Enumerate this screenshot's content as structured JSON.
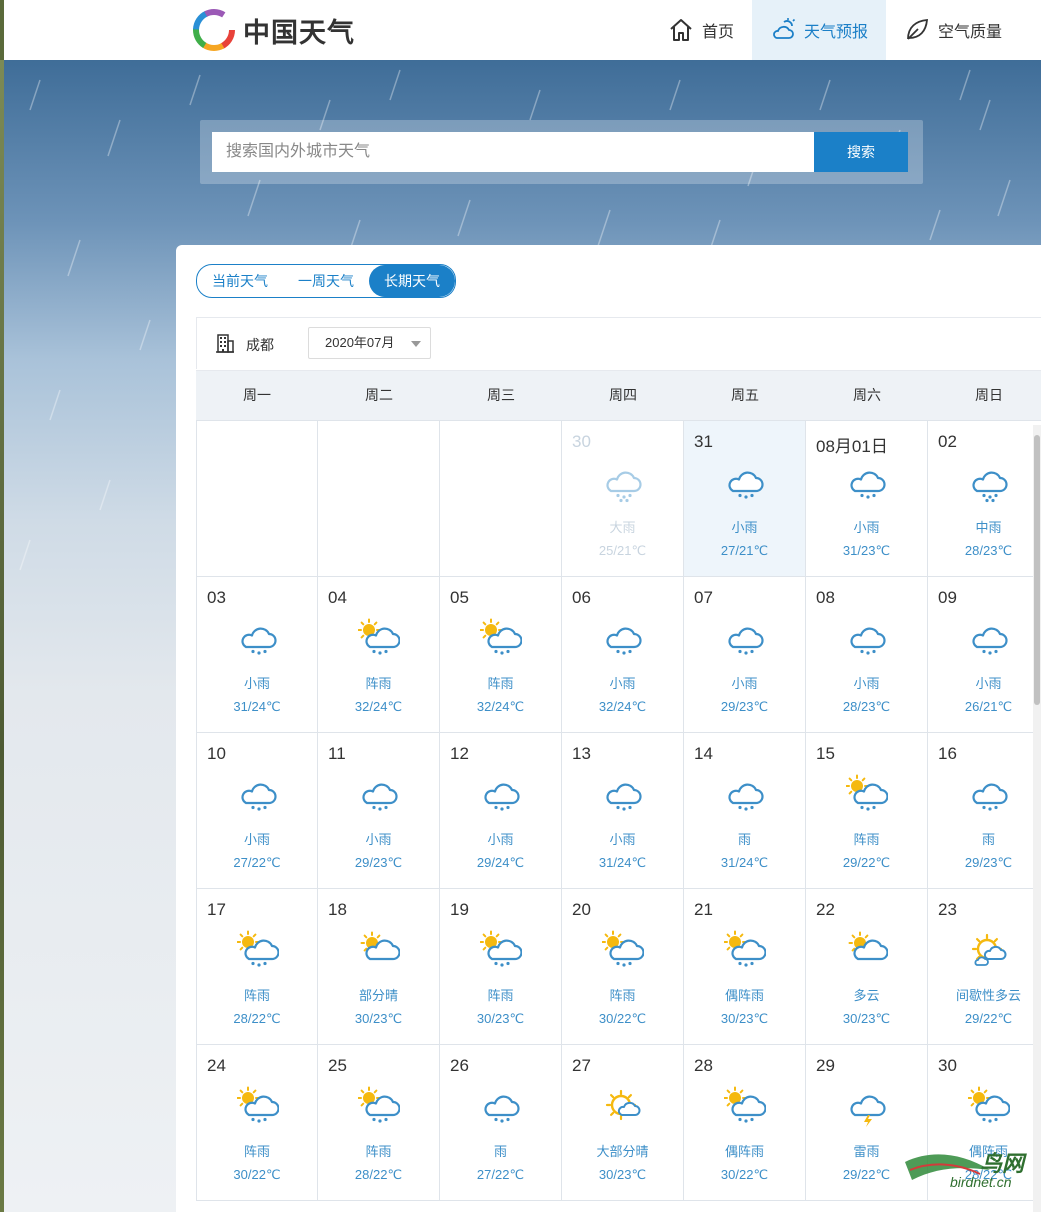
{
  "header": {
    "logo_text": "中国天气",
    "nav": [
      {
        "label": "首页",
        "icon": "home-icon"
      },
      {
        "label": "天气预报",
        "icon": "cloud-sun-icon",
        "active": true
      },
      {
        "label": "空气质量",
        "icon": "leaf-icon"
      }
    ]
  },
  "search": {
    "placeholder": "搜索国内外城市天气",
    "button_label": "搜索"
  },
  "tabs": [
    {
      "label": "当前天气"
    },
    {
      "label": "一周天气"
    },
    {
      "label": "长期天气",
      "active": true
    }
  ],
  "toolbar": {
    "city": "成都",
    "month": "2020年07月"
  },
  "weekdays": [
    "周一",
    "周二",
    "周三",
    "周四",
    "周五",
    "周六",
    "周日"
  ],
  "calendar": [
    [
      {
        "empty": true
      },
      {
        "empty": true
      },
      {
        "empty": true
      },
      {
        "date": "30",
        "desc": "大雨",
        "temp": "25/21℃",
        "icon": "heavy-rain-icon",
        "past": true
      },
      {
        "date": "31",
        "desc": "小雨",
        "temp": "27/21℃",
        "icon": "rain-icon",
        "today": true
      },
      {
        "date": "08月01日",
        "desc": "小雨",
        "temp": "31/23℃",
        "icon": "rain-icon"
      },
      {
        "date": "02",
        "desc": "中雨",
        "temp": "28/23℃",
        "icon": "heavy-rain-icon"
      }
    ],
    [
      {
        "date": "03",
        "desc": "小雨",
        "temp": "31/24℃",
        "icon": "rain-icon"
      },
      {
        "date": "04",
        "desc": "阵雨",
        "temp": "32/24℃",
        "icon": "shower-icon"
      },
      {
        "date": "05",
        "desc": "阵雨",
        "temp": "32/24℃",
        "icon": "shower-icon"
      },
      {
        "date": "06",
        "desc": "小雨",
        "temp": "32/24℃",
        "icon": "rain-icon"
      },
      {
        "date": "07",
        "desc": "小雨",
        "temp": "29/23℃",
        "icon": "rain-icon"
      },
      {
        "date": "08",
        "desc": "小雨",
        "temp": "28/23℃",
        "icon": "rain-icon"
      },
      {
        "date": "09",
        "desc": "小雨",
        "temp": "26/21℃",
        "icon": "rain-icon"
      }
    ],
    [
      {
        "date": "10",
        "desc": "小雨",
        "temp": "27/22℃",
        "icon": "rain-icon"
      },
      {
        "date": "11",
        "desc": "小雨",
        "temp": "29/23℃",
        "icon": "rain-icon"
      },
      {
        "date": "12",
        "desc": "小雨",
        "temp": "29/24℃",
        "icon": "rain-icon"
      },
      {
        "date": "13",
        "desc": "小雨",
        "temp": "31/24℃",
        "icon": "rain-icon"
      },
      {
        "date": "14",
        "desc": "雨",
        "temp": "31/24℃",
        "icon": "rain-icon"
      },
      {
        "date": "15",
        "desc": "阵雨",
        "temp": "29/22℃",
        "icon": "shower-icon"
      },
      {
        "date": "16",
        "desc": "雨",
        "temp": "29/23℃",
        "icon": "rain-icon"
      }
    ],
    [
      {
        "date": "17",
        "desc": "阵雨",
        "temp": "28/22℃",
        "icon": "shower-icon"
      },
      {
        "date": "18",
        "desc": "部分晴",
        "temp": "30/23℃",
        "icon": "partly-sunny-icon"
      },
      {
        "date": "19",
        "desc": "阵雨",
        "temp": "30/23℃",
        "icon": "shower-icon"
      },
      {
        "date": "20",
        "desc": "阵雨",
        "temp": "30/22℃",
        "icon": "shower-icon"
      },
      {
        "date": "21",
        "desc": "偶阵雨",
        "temp": "30/23℃",
        "icon": "shower-icon"
      },
      {
        "date": "22",
        "desc": "多云",
        "temp": "30/23℃",
        "icon": "partly-sunny-icon"
      },
      {
        "date": "23",
        "desc": "间歇性多云",
        "temp": "29/22℃",
        "icon": "intermittent-cloud-icon"
      }
    ],
    [
      {
        "date": "24",
        "desc": "阵雨",
        "temp": "30/22℃",
        "icon": "shower-icon"
      },
      {
        "date": "25",
        "desc": "阵雨",
        "temp": "28/22℃",
        "icon": "shower-icon"
      },
      {
        "date": "26",
        "desc": "雨",
        "temp": "27/22℃",
        "icon": "rain-icon"
      },
      {
        "date": "27",
        "desc": "大部分晴",
        "temp": "30/23℃",
        "icon": "mostly-sunny-icon"
      },
      {
        "date": "28",
        "desc": "偶阵雨",
        "temp": "30/22℃",
        "icon": "shower-icon"
      },
      {
        "date": "29",
        "desc": "雷雨",
        "temp": "29/22℃",
        "icon": "thunderstorm-icon"
      },
      {
        "date": "30",
        "desc": "偶阵雨",
        "temp": "28/22℃",
        "icon": "shower-icon"
      }
    ]
  ],
  "watermark": {
    "text": "birdnet.cn",
    "big": "鸟网"
  },
  "colors": {
    "accent": "#1b80c8",
    "weather_text": "#3d8fc8",
    "today_bg": "#eef5fb",
    "sun": "#f5b90f"
  }
}
